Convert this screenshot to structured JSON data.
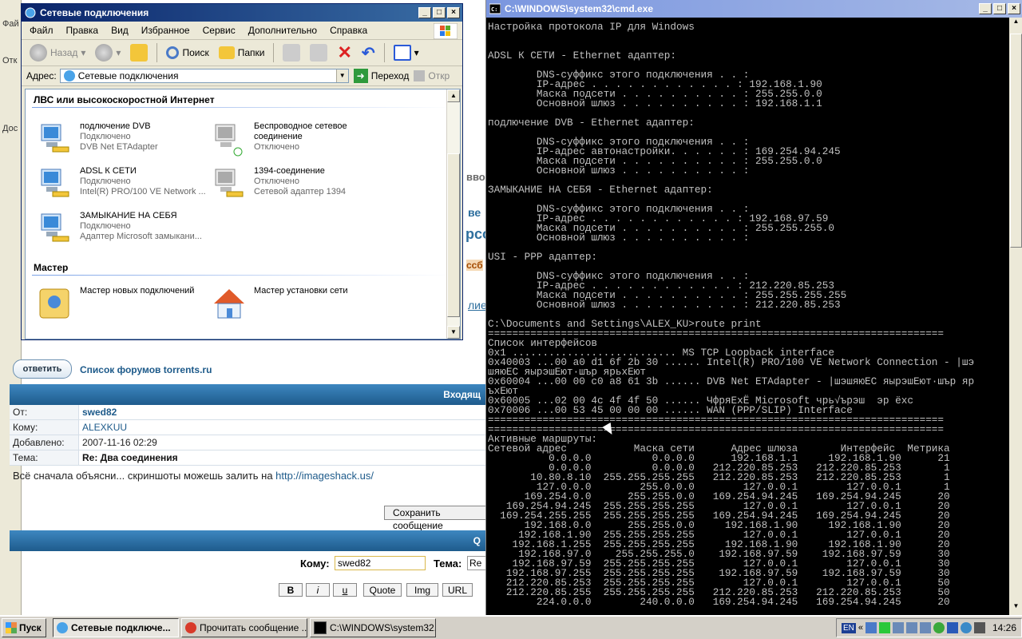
{
  "bg": {
    "strip_items": [
      "Фай",
      "Отк",
      "Дос"
    ],
    "peek_words": [
      "вво",
      "ве",
      "рсо",
      "ссб",
      "лие"
    ],
    "reply_button": "ответить",
    "forum_list_link": "Список форумов torrents.ru",
    "incoming_header": "Входящ",
    "msg": {
      "from_label": "От:",
      "from_value": "swed82",
      "to_label": "Кому:",
      "to_value": "ALEXKUU",
      "added_label": "Добавлено:",
      "added_value": "2007-11-16 02:29",
      "subject_label": "Тема:",
      "subject_value": "Re: Два соединения",
      "body_text": "Всё сначала объясни... скриншоты можешь залить на ",
      "body_link": "http://imageshack.us/"
    },
    "save_button": "Сохранить сообщение",
    "second_header": "Q",
    "reply_form": {
      "to_label": "Кому:",
      "to_value": "swed82",
      "subject_label": "Тема:",
      "subject_value": "Re",
      "format_buttons": [
        "B",
        "i",
        "u",
        "Quote",
        "Img",
        "URL"
      ]
    }
  },
  "explorer": {
    "title": "Сетевые подключения",
    "menu": [
      "Файл",
      "Правка",
      "Вид",
      "Избранное",
      "Сервис",
      "Дополнительно",
      "Справка"
    ],
    "toolbar": {
      "back": "Назад",
      "search": "Поиск",
      "folders": "Папки"
    },
    "address_label": "Адрес:",
    "address_value": "Сетевые подключения",
    "go_label": "Переход",
    "open_label": "Откр",
    "group_lan": "ЛВС или высокоскоростной Интернет",
    "group_wizard": "Мастер",
    "connections": [
      {
        "name": "подлючение DVB",
        "status": "Подключено",
        "device": "DVB Net ETAdapter"
      },
      {
        "name": "Беспроводное сетевое соединение",
        "status": "Отключено",
        "device": ""
      },
      {
        "name": "ADSL К СЕТИ",
        "status": "Подключено",
        "device": "Intel(R) PRO/100 VE Network ..."
      },
      {
        "name": "1394-соединение",
        "status": "Отключено",
        "device": "Сетевой адаптер 1394"
      },
      {
        "name": "ЗАМЫКАНИЕ НА СЕБЯ",
        "status": "Подключено",
        "device": "Адаптер Microsoft замыкани..."
      }
    ],
    "wizards": [
      "Мастер новых подключений",
      "Мастер установки сети"
    ]
  },
  "cmd": {
    "title": "C:\\WINDOWS\\system32\\cmd.exe",
    "text": "Настройка протокола IP для Windows\n\n\nADSL К СЕТИ - Ethernet адаптер:\n\n        DNS-суффикс этого подключения . . :\n        IP-адрес . . . . . . . . . . . . : 192.168.1.90\n        Маска подсети . . . . . . . . . . : 255.255.0.0\n        Основной шлюз . . . . . . . . . . : 192.168.1.1\n\nподлючение DVB - Ethernet адаптер:\n\n        DNS-суффикс этого подключения . . :\n        IP-адрес автонастройки. . . . . . : 169.254.94.245\n        Маска подсети . . . . . . . . . . : 255.255.0.0\n        Основной шлюз . . . . . . . . . . :\n\nЗАМЫКАНИЕ НА СЕБЯ - Ethernet адаптер:\n\n        DNS-суффикс этого подключения . . :\n        IP-адрес . . . . . . . . . . . . : 192.168.97.59\n        Маска подсети . . . . . . . . . . : 255.255.255.0\n        Основной шлюз . . . . . . . . . . :\n\nUSI - PPP адаптер:\n\n        DNS-суффикс этого подключения . . :\n        IP-адрес . . . . . . . . . . . . : 212.220.85.253\n        Маска подсети . . . . . . . . . . : 255.255.255.255\n        Основной шлюз . . . . . . . . . . : 212.220.85.253\n\nC:\\Documents and Settings\\ALEX_KU>route print\n===========================================================================\nСписок интерфейсов\n0x1 ........................... MS TCP Loopback interface\n0x40003 ...00 a0 d1 6f 2b 30 ...... Intel(R) PRO/100 VE Network Connection - |шэ\nшяюЕС яырэшЕют·шър ярьхЕют\n0x60004 ...00 00 c0 a8 61 3b ...... DVB Net ETAdapter - |шэшяюЕС яырэшЕют·шър яр\nъхЕют\n0x60005 ...02 00 4c 4f 4f 50 ...... ЧфряЕхЁ Microsoft чрь√ърэш  эр ёхс\n0x70006 ...00 53 45 00 00 00 ...... WAN (PPP/SLIP) Interface\n===========================================================================\n===========================================================================\nАктивные маршруты:\nСетевой адрес           Маска сети      Адрес шлюза       Интерфейс  Метрика\n          0.0.0.0          0.0.0.0      192.168.1.1     192.168.1.90      21\n          0.0.0.0          0.0.0.0   212.220.85.253   212.220.85.253       1\n       10.80.8.10  255.255.255.255   212.220.85.253   212.220.85.253       1\n        127.0.0.0        255.0.0.0        127.0.0.1        127.0.0.1       1\n      169.254.0.0      255.255.0.0   169.254.94.245   169.254.94.245      20\n   169.254.94.245  255.255.255.255        127.0.0.1        127.0.0.1      20\n  169.254.255.255  255.255.255.255   169.254.94.245   169.254.94.245      20\n      192.168.0.0      255.255.0.0     192.168.1.90     192.168.1.90      20\n     192.168.1.90  255.255.255.255        127.0.0.1        127.0.0.1      20\n    192.168.1.255  255.255.255.255     192.168.1.90     192.168.1.90      20\n     192.168.97.0    255.255.255.0    192.168.97.59    192.168.97.59      30\n    192.168.97.59  255.255.255.255        127.0.0.1        127.0.0.1      30\n   192.168.97.255  255.255.255.255    192.168.97.59    192.168.97.59      30\n   212.220.85.253  255.255.255.255        127.0.0.1        127.0.0.1      50\n   212.220.85.255  255.255.255.255   212.220.85.253   212.220.85.253      50\n        224.0.0.0        240.0.0.0   169.254.94.245   169.254.94.245      20"
  },
  "taskbar": {
    "start": "Пуск",
    "tasks": [
      "Сетевые подключе...",
      "Прочитать сообщение ...",
      "C:\\WINDOWS\\system32..."
    ],
    "lang": "EN",
    "time": "14:26"
  }
}
